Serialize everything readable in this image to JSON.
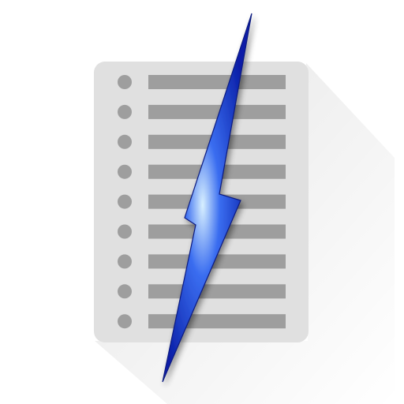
{
  "icon": {
    "name": "fast-list-app-icon",
    "background_color": "#ffffff",
    "card_color": "#e0e0e0",
    "bullet_color": "#9e9e9e",
    "line_color": "#9e9e9e",
    "shadow_color": "#000000",
    "bolt_colors": {
      "light": "#d8f0ff",
      "mid": "#3a6df0",
      "dark": "#0a1fa8"
    },
    "list_row_count": 9
  }
}
